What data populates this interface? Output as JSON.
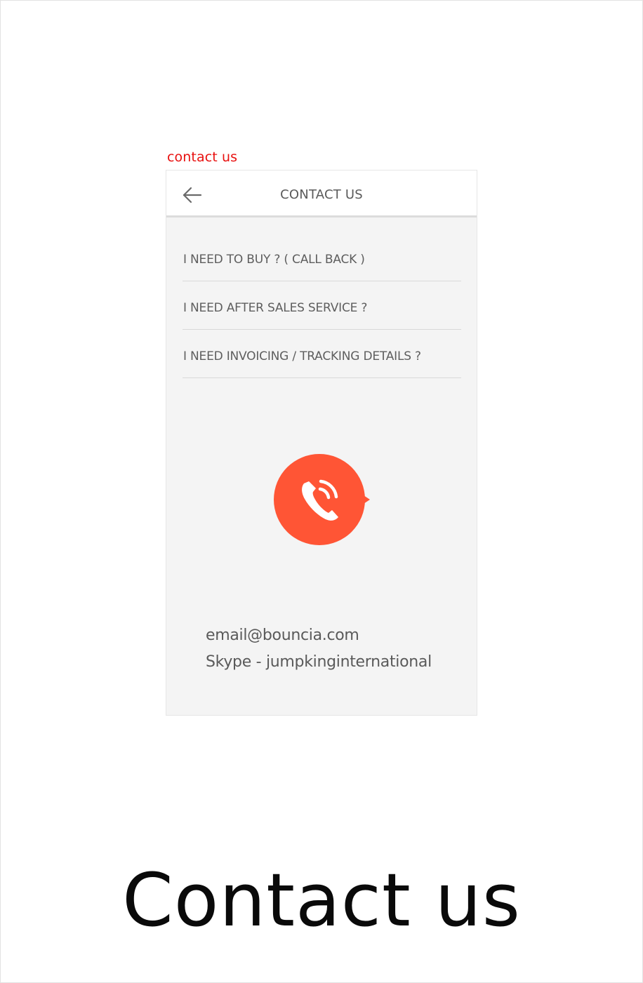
{
  "screen_caption": "contact us",
  "header": {
    "title": "CONTACT US",
    "back_icon": "arrow-left-icon"
  },
  "menu": {
    "items": [
      {
        "label": "I NEED TO BUY ? ( CALL BACK )"
      },
      {
        "label": "I NEED AFTER SALES SERVICE ?"
      },
      {
        "label": "I NEED INVOICING / TRACKING DETAILS ?"
      }
    ]
  },
  "call_button": {
    "icon": "phone-call-icon",
    "color": "#ff5535"
  },
  "contact": {
    "email": "email@bouncia.com",
    "skype": "Skype - jumpkinginternational"
  },
  "page_title": "Contact us",
  "colors": {
    "caption": "#e8100f",
    "accent": "#ff5535",
    "text": "#5a5a5a",
    "screen_bg": "#f4f4f4"
  }
}
